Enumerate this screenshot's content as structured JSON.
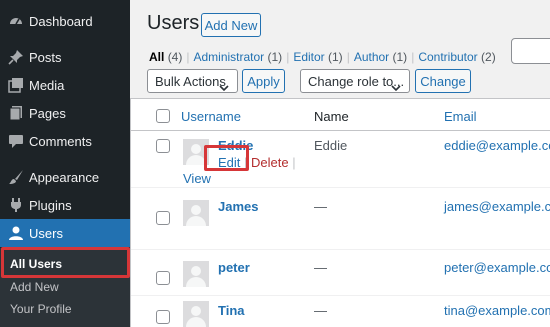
{
  "sidebar": {
    "items": [
      {
        "label": "Dashboard",
        "icon": "dashboard-icon"
      },
      {
        "label": "Posts",
        "icon": "pin-icon"
      },
      {
        "label": "Media",
        "icon": "media-icon"
      },
      {
        "label": "Pages",
        "icon": "pages-icon"
      },
      {
        "label": "Comments",
        "icon": "comment-icon"
      },
      {
        "label": "Appearance",
        "icon": "brush-icon"
      },
      {
        "label": "Plugins",
        "icon": "plug-icon"
      },
      {
        "label": "Users",
        "icon": "user-icon"
      }
    ],
    "submenu": [
      "All Users",
      "Add New",
      "Your Profile"
    ]
  },
  "header": {
    "title": "Users",
    "add_new": "Add New"
  },
  "filters": [
    {
      "label": "All",
      "count": "(4)",
      "current": true
    },
    {
      "label": "Administrator",
      "count": "(1)"
    },
    {
      "label": "Editor",
      "count": "(1)"
    },
    {
      "label": "Author",
      "count": "(1)"
    },
    {
      "label": "Contributor",
      "count": "(2)"
    }
  ],
  "toolbar": {
    "bulk_actions": "Bulk Actions",
    "apply": "Apply",
    "change_role": "Change role to...",
    "change": "Change"
  },
  "table": {
    "columns": [
      "Username",
      "Name",
      "Email"
    ],
    "rows": [
      {
        "username": "Eddie",
        "name": "Eddie",
        "email": "eddie@example.com"
      },
      {
        "username": "James",
        "name": "—",
        "email": "james@example.com"
      },
      {
        "username": "peter",
        "name": "—",
        "email": "peter@example.com"
      },
      {
        "username": "Tina",
        "name": "—",
        "email": "tina@example.com"
      }
    ],
    "row_actions": {
      "edit": "Edit",
      "delete": "Delete",
      "view": "View",
      "separator": "|"
    }
  },
  "colors": {
    "accent": "#2271b1",
    "highlight": "#d63638",
    "sidebar": "#1d2327"
  }
}
